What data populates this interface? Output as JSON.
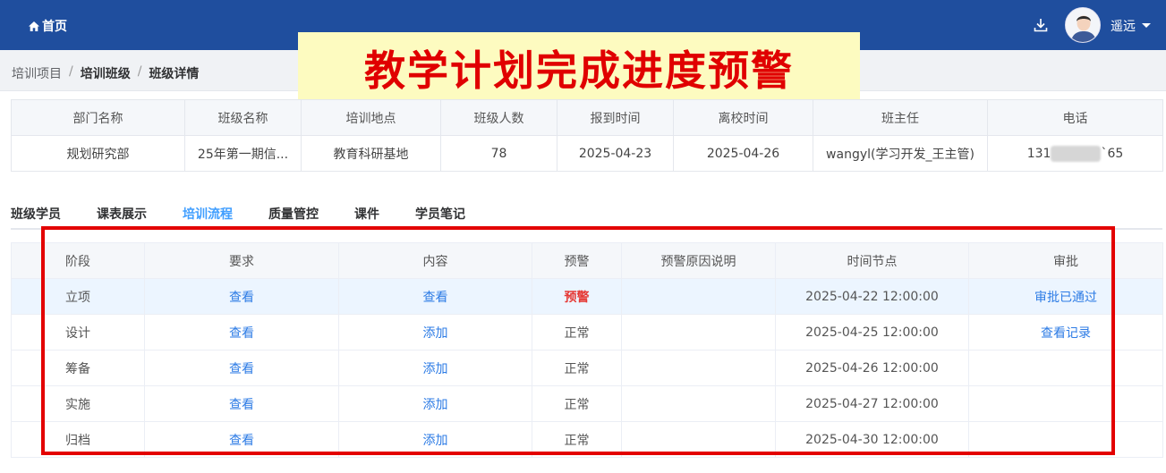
{
  "topbar": {
    "home_label": "首页",
    "user_name": "遥远",
    "brand_color": "#1f4e9e"
  },
  "breadcrumb": [
    "培训项目",
    "培训班级",
    "班级详情"
  ],
  "banner": {
    "text": "教学计划完成进度预警"
  },
  "info_table": {
    "headers": [
      "部门名称",
      "班级名称",
      "培训地点",
      "班级人数",
      "报到时间",
      "离校时间",
      "班主任",
      "电话"
    ],
    "row": [
      "规划研究部",
      "25年第一期信...",
      "教育科研基地",
      "78",
      "2025-04-23",
      "2025-04-26",
      "wangyl(学习开发_王主管)"
    ],
    "phone_prefix": "131",
    "phone_suffix": "`65"
  },
  "tabs": [
    "班级学员",
    "课表展示",
    "培训流程",
    "质量管控",
    "课件",
    "学员笔记"
  ],
  "active_tab": "培训流程",
  "flow_table": {
    "headers": [
      "阶段",
      "要求",
      "内容",
      "预警",
      "预警原因说明",
      "时间节点",
      "审批"
    ],
    "rows": [
      {
        "stage": "立项",
        "req": "查看",
        "content": "查看",
        "warn": "预警",
        "reason": "",
        "time": "2025-04-22 12:00:00",
        "approve": "审批已通过"
      },
      {
        "stage": "设计",
        "req": "查看",
        "content": "添加",
        "warn": "正常",
        "reason": "",
        "time": "2025-04-25 12:00:00",
        "approve": "查看记录"
      },
      {
        "stage": "筹备",
        "req": "查看",
        "content": "添加",
        "warn": "正常",
        "reason": "",
        "time": "2025-04-26 12:00:00",
        "approve": ""
      },
      {
        "stage": "实施",
        "req": "查看",
        "content": "添加",
        "warn": "正常",
        "reason": "",
        "time": "2025-04-27 12:00:00",
        "approve": ""
      },
      {
        "stage": "归档",
        "req": "查看",
        "content": "添加",
        "warn": "正常",
        "reason": "",
        "time": "2025-04-30 12:00:00",
        "approve": ""
      }
    ]
  }
}
